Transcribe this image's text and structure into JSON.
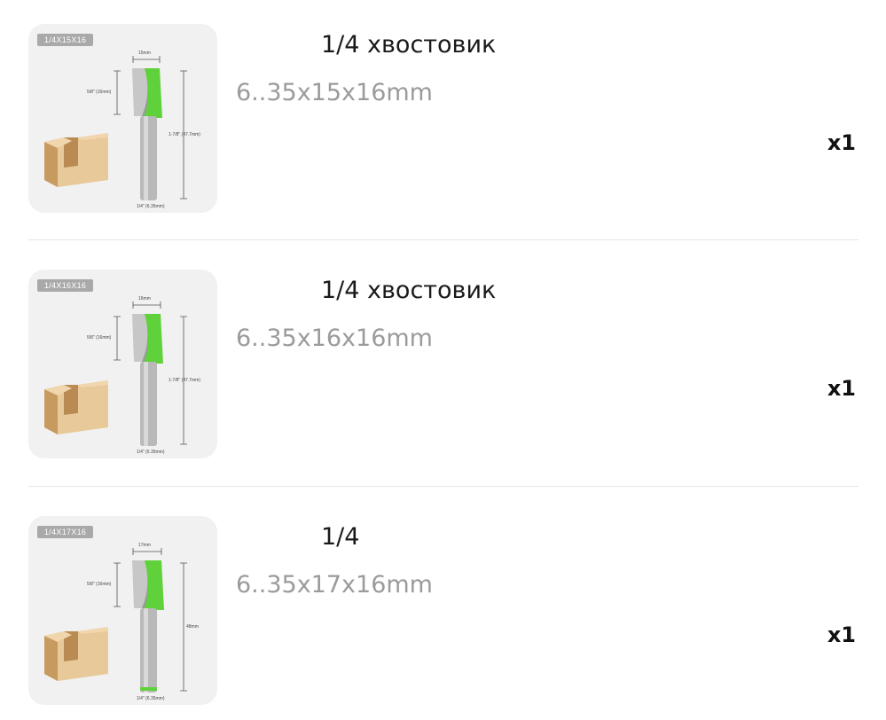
{
  "items": [
    {
      "image_tag": "1/4X15X16",
      "dim_top": "15mm",
      "dim_left": "5/8\" (16mm)",
      "dim_right": "1-7/8\" (47.7mm)",
      "dim_bottom": "1/4\" (6.35mm)",
      "title": "1/4 хвостовик",
      "spec": "6..35x15x16mm",
      "quantity": "x1"
    },
    {
      "image_tag": "1/4X16X16",
      "dim_top": "16mm",
      "dim_left": "5/8\" (16mm)",
      "dim_right": "1-7/8\" (47.7mm)",
      "dim_bottom": "1/4\" (6.35mm)",
      "title": "1/4 хвостовик",
      "spec": "6..35x16x16mm",
      "quantity": "x1"
    },
    {
      "image_tag": "1/4X17X16",
      "dim_top": "17mm",
      "dim_left": "5/8\" (16mm)",
      "dim_right": "48mm",
      "dim_bottom": "1/4\" (6.35mm)",
      "title": "1/4",
      "spec": "6..35x17x16mm",
      "quantity": "x1"
    }
  ],
  "colors": {
    "bit_green": "#5fd13a",
    "shank_gray": "#b9b9b9",
    "wood": "#e8c99a"
  }
}
